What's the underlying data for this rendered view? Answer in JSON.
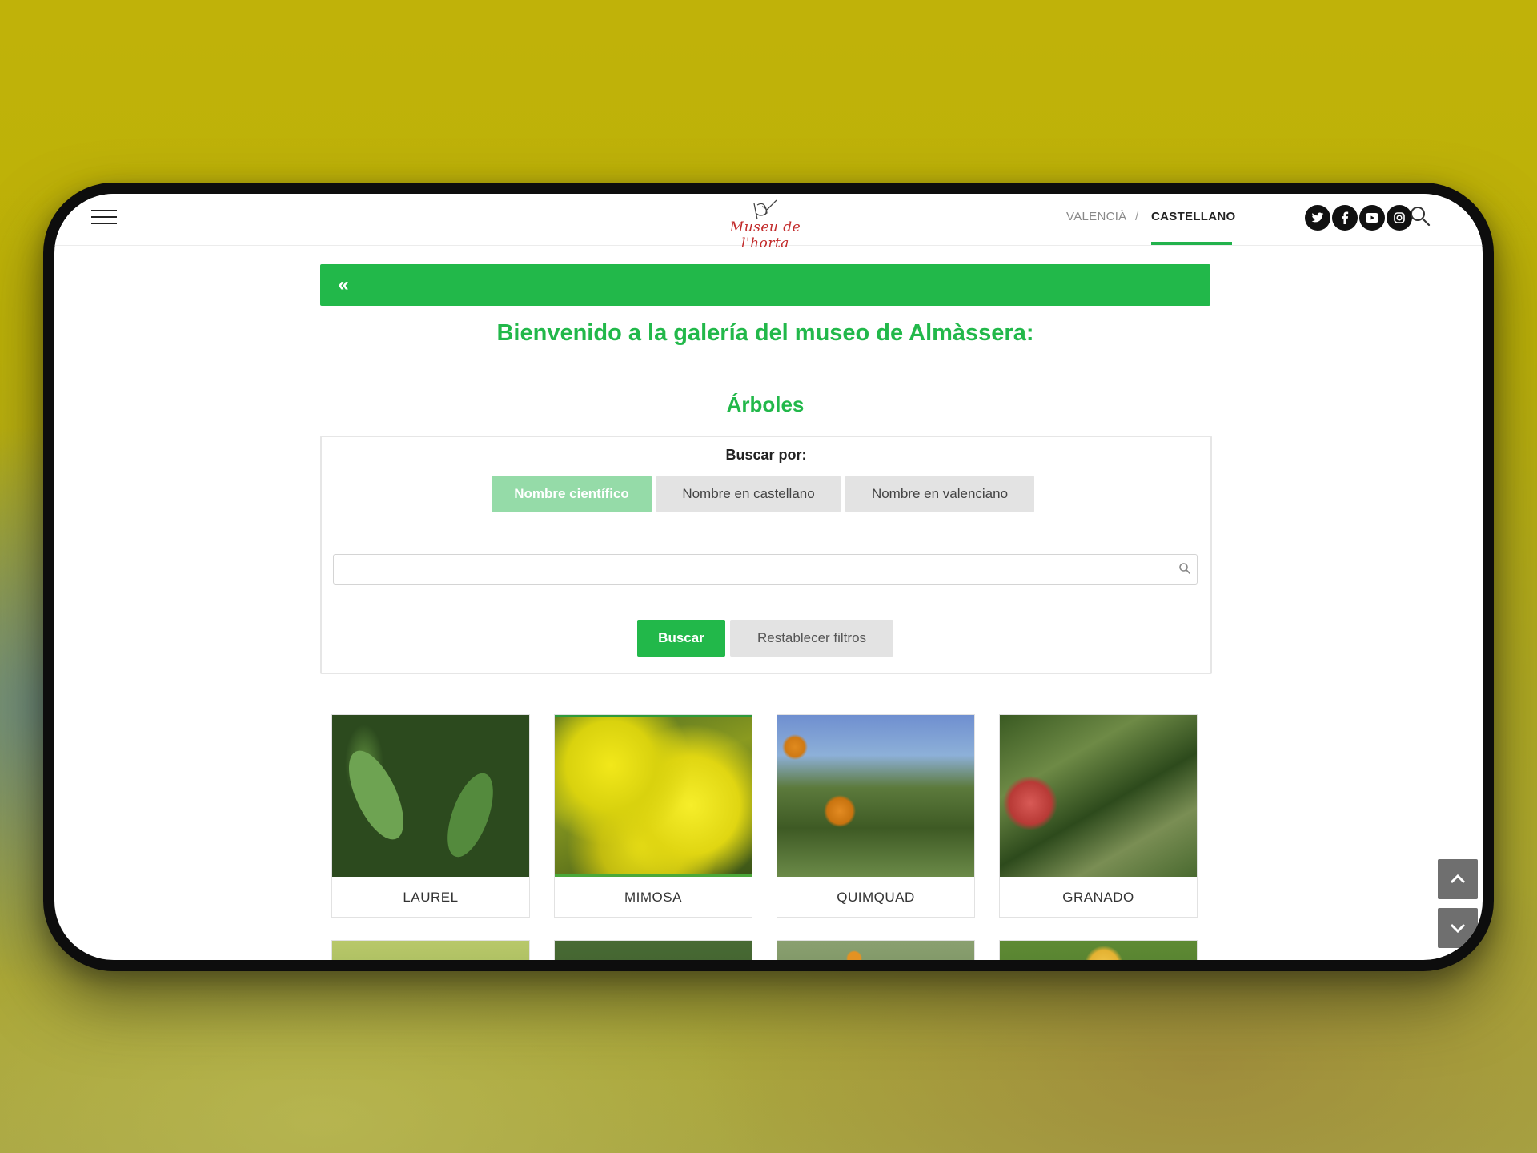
{
  "header": {
    "logo_text": "Museu de l'horta",
    "languages": [
      {
        "label": "VALENCIÀ",
        "active": false
      },
      {
        "label": "CASTELLANO",
        "active": true
      }
    ],
    "language_separator": "/",
    "social_icons": [
      "twitter-icon",
      "facebook-icon",
      "youtube-icon",
      "instagram-icon"
    ]
  },
  "page": {
    "back_glyph": "«",
    "welcome": "Bienvenido a la galería del museo de Almàssera:",
    "section_title": "Árboles"
  },
  "filter": {
    "search_by_label": "Buscar por:",
    "tabs": [
      {
        "label": "Nombre científico",
        "active": true
      },
      {
        "label": "Nombre en castellano",
        "active": false
      },
      {
        "label": "Nombre en valenciano",
        "active": false
      }
    ],
    "search_value": "",
    "search_placeholder": "",
    "search_button": "Buscar",
    "reset_button": "Restablecer filtros"
  },
  "gallery": {
    "items": [
      {
        "name": "LAUREL"
      },
      {
        "name": "MIMOSA"
      },
      {
        "name": "QUIMQUAD"
      },
      {
        "name": "GRANADO"
      }
    ]
  },
  "colors": {
    "accent": "#22b84a",
    "accent_light": "#95dba8",
    "logo_red": "#c22a2a"
  }
}
